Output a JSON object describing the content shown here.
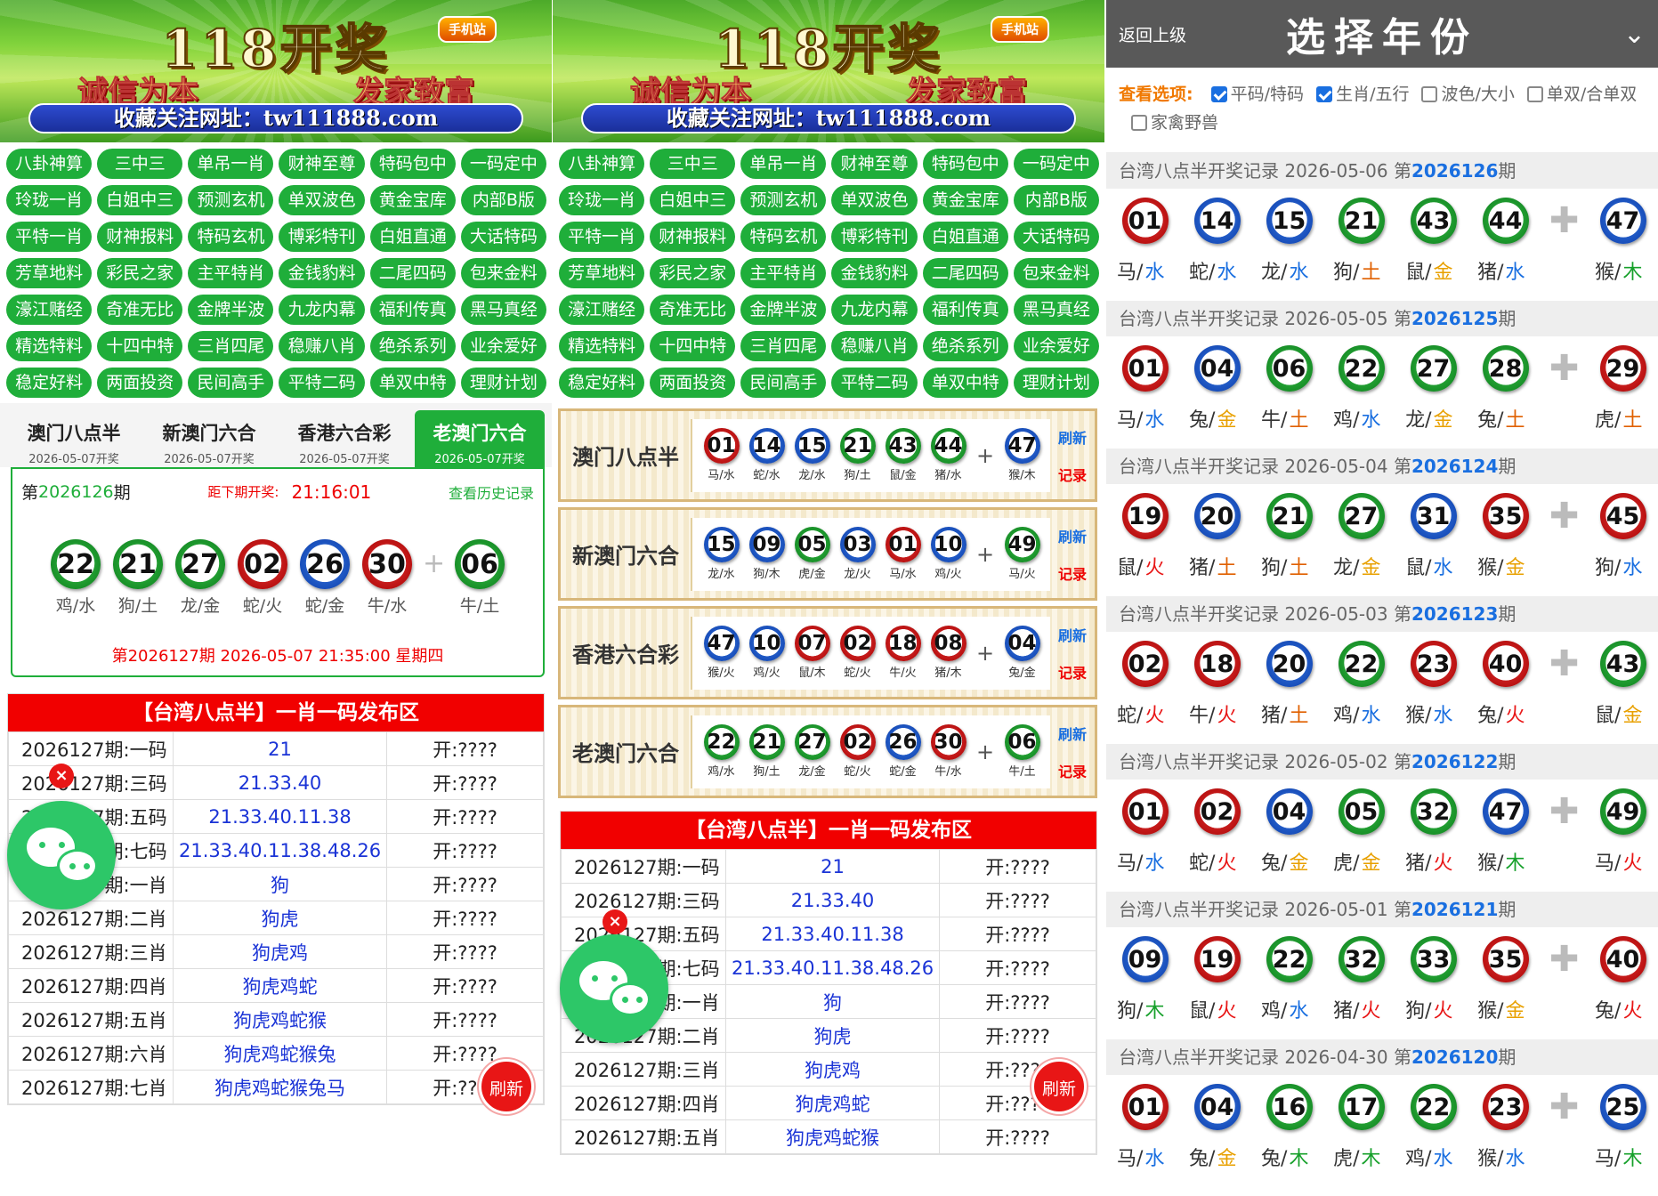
{
  "banner": {
    "title": "118开奖",
    "tag": "手机站",
    "slogan_left": "诚信为本",
    "slogan_right": "发家致富",
    "url": "收藏关注网址：tw111888.com"
  },
  "nav_buttons": [
    "八卦神算",
    "三中三",
    "单吊一肖",
    "财神至尊",
    "特码包中",
    "一码定中",
    "玲珑一肖",
    "白姐中三",
    "预测玄机",
    "单双波色",
    "黄金宝库",
    "内部B版",
    "平特一肖",
    "财神报料",
    "特码玄机",
    "博彩特刊",
    "白姐直通",
    "大话特码",
    "芳草地料",
    "彩民之家",
    "主平特肖",
    "金钱豹料",
    "二尾四码",
    "包来金料",
    "濠江赌经",
    "奇准无比",
    "金牌半波",
    "九龙内幕",
    "福利传真",
    "黑马真经",
    "精选特料",
    "十四中特",
    "三肖四尾",
    "稳赚八肖",
    "绝杀系列",
    "业余爱好",
    "稳定好料",
    "两面投资",
    "民间高手",
    "平特二码",
    "单双中特",
    "理财计划"
  ],
  "colors": {
    "green": "#1fae3a",
    "red": "#f10000",
    "blue": "#1a6fe0"
  },
  "lottery_tabs": [
    {
      "name": "澳门八点半",
      "date": "2026-05-07开奖"
    },
    {
      "name": "新澳门六合",
      "date": "2026-05-07开奖"
    },
    {
      "name": "香港六合彩",
      "date": "2026-05-07开奖"
    },
    {
      "name": "老澳门六合",
      "date": "2026-05-07开奖"
    }
  ],
  "current_draw": {
    "issue_prefix": "第",
    "issue": "2026126",
    "issue_suffix": "期",
    "countdown_label": "距下期开奖:",
    "countdown": "21:16:01",
    "history_link": "查看历史记录",
    "balls": [
      {
        "num": "22",
        "color": "green",
        "zodiac": "鸡/水"
      },
      {
        "num": "21",
        "color": "green",
        "zodiac": "狗/土"
      },
      {
        "num": "27",
        "color": "green",
        "zodiac": "龙/金"
      },
      {
        "num": "02",
        "color": "red",
        "zodiac": "蛇/火"
      },
      {
        "num": "26",
        "color": "blue",
        "zodiac": "蛇/金"
      },
      {
        "num": "30",
        "color": "red",
        "zodiac": "牛/水"
      }
    ],
    "special": {
      "num": "06",
      "color": "green",
      "zodiac": "牛/土"
    },
    "plus": "+",
    "next_draw": "第2026127期 2026-05-07 21:35:00 星期四"
  },
  "publish": {
    "header": "【台湾八点半】一肖一码发布区",
    "rows": [
      {
        "label": "2026127期:一码",
        "value": "21",
        "open": "开:????"
      },
      {
        "label": "2026127期:三码",
        "value": "21.33.40",
        "open": "开:????"
      },
      {
        "label": "2026127期:五码",
        "value": "21.33.40.11.38",
        "open": "开:????"
      },
      {
        "label": "2026127期:七码",
        "value": "21.33.40.11.38.48.26",
        "open": "开:????"
      },
      {
        "label": "2026127期:一肖",
        "value": "狗",
        "open": "开:????"
      },
      {
        "label": "2026127期:二肖",
        "value": "狗虎",
        "open": "开:????"
      },
      {
        "label": "2026127期:三肖",
        "value": "狗虎鸡",
        "open": "开:????"
      },
      {
        "label": "2026127期:四肖",
        "value": "狗虎鸡蛇",
        "open": "开:????"
      },
      {
        "label": "2026127期:五肖",
        "value": "狗虎鸡蛇猴",
        "open": "开:????"
      },
      {
        "label": "2026127期:六肖",
        "value": "狗虎鸡蛇猴兔",
        "open": "开:????"
      },
      {
        "label": "2026127期:七肖",
        "value": "狗虎鸡蛇猴兔马",
        "open": "开:????"
      }
    ]
  },
  "lottery_list": [
    {
      "name": "澳门八点半",
      "balls": [
        {
          "num": "01",
          "color": "red",
          "zodiac": "马/水"
        },
        {
          "num": "14",
          "color": "blue",
          "zodiac": "蛇/水"
        },
        {
          "num": "15",
          "color": "blue",
          "zodiac": "龙/水"
        },
        {
          "num": "21",
          "color": "green",
          "zodiac": "狗/土"
        },
        {
          "num": "43",
          "color": "green",
          "zodiac": "鼠/金"
        },
        {
          "num": "44",
          "color": "green",
          "zodiac": "猪/水"
        }
      ],
      "special": {
        "num": "47",
        "color": "blue",
        "zodiac": "猴/木"
      }
    },
    {
      "name": "新澳门六合",
      "balls": [
        {
          "num": "15",
          "color": "blue",
          "zodiac": "龙/水"
        },
        {
          "num": "09",
          "color": "blue",
          "zodiac": "狗/木"
        },
        {
          "num": "05",
          "color": "green",
          "zodiac": "虎/金"
        },
        {
          "num": "03",
          "color": "blue",
          "zodiac": "龙/火"
        },
        {
          "num": "01",
          "color": "red",
          "zodiac": "马/水"
        },
        {
          "num": "10",
          "color": "blue",
          "zodiac": "鸡/火"
        }
      ],
      "special": {
        "num": "49",
        "color": "green",
        "zodiac": "马/火"
      }
    },
    {
      "name": "香港六合彩",
      "balls": [
        {
          "num": "47",
          "color": "blue",
          "zodiac": "猴/火"
        },
        {
          "num": "10",
          "color": "blue",
          "zodiac": "鸡/火"
        },
        {
          "num": "07",
          "color": "red",
          "zodiac": "鼠/木"
        },
        {
          "num": "02",
          "color": "red",
          "zodiac": "蛇/火"
        },
        {
          "num": "18",
          "color": "red",
          "zodiac": "牛/火"
        },
        {
          "num": "08",
          "color": "red",
          "zodiac": "猪/木"
        }
      ],
      "special": {
        "num": "04",
        "color": "blue",
        "zodiac": "兔/金"
      }
    },
    {
      "name": "老澳门六合",
      "balls": [
        {
          "num": "22",
          "color": "green",
          "zodiac": "鸡/水"
        },
        {
          "num": "21",
          "color": "green",
          "zodiac": "狗/土"
        },
        {
          "num": "27",
          "color": "green",
          "zodiac": "龙/金"
        },
        {
          "num": "02",
          "color": "red",
          "zodiac": "蛇/火"
        },
        {
          "num": "26",
          "color": "blue",
          "zodiac": "蛇/金"
        },
        {
          "num": "30",
          "color": "red",
          "zodiac": "牛/水"
        }
      ],
      "special": {
        "num": "06",
        "color": "green",
        "zodiac": "牛/土"
      }
    }
  ],
  "lottery_side": {
    "refresh": "刷新",
    "record": "记录"
  },
  "publish2_rows_visible": 9,
  "floating": {
    "refresh": "刷新",
    "close": "×",
    "chat_icon": "wechat-icon"
  },
  "year_panel": {
    "back": "返回上级",
    "title": "选择年份",
    "chevron": "⌄",
    "options_label": "查看选项:",
    "options": [
      {
        "label": "平码/特码",
        "checked": true
      },
      {
        "label": "生肖/五行",
        "checked": true
      },
      {
        "label": "波色/大小",
        "checked": false
      },
      {
        "label": "单双/合单双",
        "checked": false
      },
      {
        "label": "家禽野兽",
        "checked": false
      }
    ]
  },
  "records": [
    {
      "title": "台湾八点半开奖记录 2026-05-06 第",
      "issue": "2026126",
      "suffix": "期",
      "balls": [
        [
          "01",
          "red",
          "马",
          "水"
        ],
        [
          "14",
          "blue",
          "蛇",
          "水"
        ],
        [
          "15",
          "blue",
          "龙",
          "水"
        ],
        [
          "21",
          "green",
          "狗",
          "土"
        ],
        [
          "43",
          "green",
          "鼠",
          "金"
        ],
        [
          "44",
          "green",
          "猪",
          "水"
        ]
      ],
      "special": [
        "47",
        "blue",
        "猴",
        "木"
      ]
    },
    {
      "title": "台湾八点半开奖记录 2026-05-05 第",
      "issue": "2026125",
      "suffix": "期",
      "balls": [
        [
          "01",
          "red",
          "马",
          "水"
        ],
        [
          "04",
          "blue",
          "兔",
          "金"
        ],
        [
          "06",
          "green",
          "牛",
          "土"
        ],
        [
          "22",
          "green",
          "鸡",
          "水"
        ],
        [
          "27",
          "green",
          "龙",
          "金"
        ],
        [
          "28",
          "green",
          "兔",
          "土"
        ]
      ],
      "special": [
        "29",
        "red",
        "虎",
        "土"
      ]
    },
    {
      "title": "台湾八点半开奖记录 2026-05-04 第",
      "issue": "2026124",
      "suffix": "期",
      "balls": [
        [
          "19",
          "red",
          "鼠",
          "火"
        ],
        [
          "20",
          "blue",
          "猪",
          "土"
        ],
        [
          "21",
          "green",
          "狗",
          "土"
        ],
        [
          "27",
          "green",
          "龙",
          "金"
        ],
        [
          "31",
          "blue",
          "鼠",
          "水"
        ],
        [
          "35",
          "red",
          "猴",
          "金"
        ]
      ],
      "special": [
        "45",
        "red",
        "狗",
        "水"
      ]
    },
    {
      "title": "台湾八点半开奖记录 2026-05-03 第",
      "issue": "2026123",
      "suffix": "期",
      "balls": [
        [
          "02",
          "red",
          "蛇",
          "火"
        ],
        [
          "18",
          "red",
          "牛",
          "火"
        ],
        [
          "20",
          "blue",
          "猪",
          "土"
        ],
        [
          "22",
          "green",
          "鸡",
          "水"
        ],
        [
          "23",
          "red",
          "猴",
          "水"
        ],
        [
          "40",
          "red",
          "兔",
          "火"
        ]
      ],
      "special": [
        "43",
        "green",
        "鼠",
        "金"
      ]
    },
    {
      "title": "台湾八点半开奖记录 2026-05-02 第",
      "issue": "2026122",
      "suffix": "期",
      "balls": [
        [
          "01",
          "red",
          "马",
          "水"
        ],
        [
          "02",
          "red",
          "蛇",
          "火"
        ],
        [
          "04",
          "blue",
          "兔",
          "金"
        ],
        [
          "05",
          "green",
          "虎",
          "金"
        ],
        [
          "32",
          "green",
          "猪",
          "火"
        ],
        [
          "47",
          "blue",
          "猴",
          "木"
        ]
      ],
      "special": [
        "49",
        "green",
        "马",
        "火"
      ]
    },
    {
      "title": "台湾八点半开奖记录 2026-05-01 第",
      "issue": "2026121",
      "suffix": "期",
      "balls": [
        [
          "09",
          "blue",
          "狗",
          "木"
        ],
        [
          "19",
          "red",
          "鼠",
          "火"
        ],
        [
          "22",
          "green",
          "鸡",
          "水"
        ],
        [
          "32",
          "green",
          "猪",
          "火"
        ],
        [
          "33",
          "green",
          "狗",
          "火"
        ],
        [
          "35",
          "red",
          "猴",
          "金"
        ]
      ],
      "special": [
        "40",
        "red",
        "兔",
        "火"
      ]
    },
    {
      "title": "台湾八点半开奖记录 2026-04-30 第",
      "issue": "2026120",
      "suffix": "期",
      "balls": [
        [
          "01",
          "red",
          "马",
          "水"
        ],
        [
          "04",
          "blue",
          "兔",
          "金"
        ],
        [
          "16",
          "green",
          "兔",
          "木"
        ],
        [
          "17",
          "green",
          "虎",
          "木"
        ],
        [
          "22",
          "green",
          "鸡",
          "水"
        ],
        [
          "23",
          "red",
          "猴",
          "水"
        ]
      ],
      "special": [
        "25",
        "blue",
        "马",
        "木"
      ]
    }
  ]
}
